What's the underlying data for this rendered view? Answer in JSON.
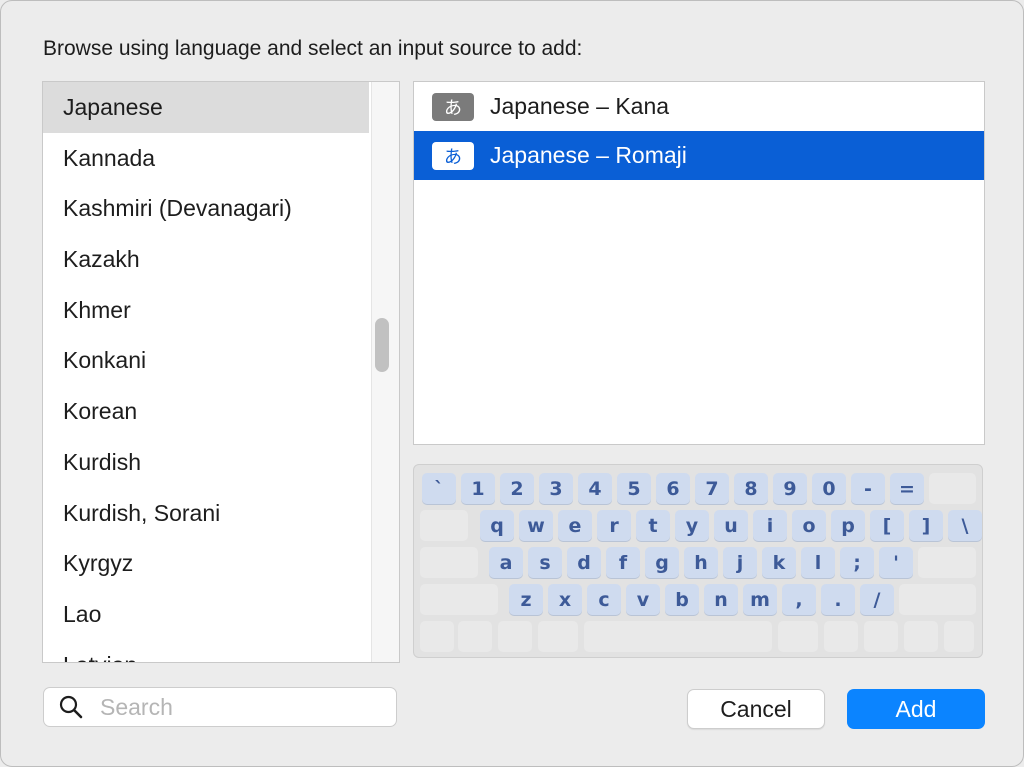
{
  "prompt": "Browse using language and select an input source to add:",
  "languages": [
    {
      "label": "Japanese",
      "selected": true
    },
    {
      "label": "Kannada"
    },
    {
      "label": "Kashmiri (Devanagari)"
    },
    {
      "label": "Kazakh"
    },
    {
      "label": "Khmer"
    },
    {
      "label": "Konkani"
    },
    {
      "label": "Korean"
    },
    {
      "label": "Kurdish"
    },
    {
      "label": "Kurdish, Sorani"
    },
    {
      "label": "Kyrgyz"
    },
    {
      "label": "Lao"
    },
    {
      "label": "Latvian"
    }
  ],
  "input_sources": [
    {
      "icon": "あ",
      "label": "Japanese – Kana",
      "selected": false
    },
    {
      "icon": "あ",
      "label": "Japanese – Romaji",
      "selected": true
    }
  ],
  "keyboard": {
    "row1": [
      "`",
      "1",
      "2",
      "3",
      "4",
      "5",
      "6",
      "7",
      "8",
      "9",
      "0",
      "-",
      "="
    ],
    "row2": [
      "q",
      "w",
      "e",
      "r",
      "t",
      "y",
      "u",
      "i",
      "o",
      "p",
      "[",
      "]",
      "\\"
    ],
    "row3": [
      "a",
      "s",
      "d",
      "f",
      "g",
      "h",
      "j",
      "k",
      "l",
      ";",
      "'"
    ],
    "row4": [
      "z",
      "x",
      "c",
      "v",
      "b",
      "n",
      "m",
      ",",
      ".",
      "/"
    ]
  },
  "search": {
    "placeholder": "Search",
    "value": "",
    "icon": "magnifier-icon"
  },
  "buttons": {
    "cancel": "Cancel",
    "add": "Add"
  },
  "colors": {
    "selection_blue": "#0a5fd6",
    "add_button": "#0b84ff",
    "key_fill": "#cfdbef",
    "key_text": "#3d5a98"
  }
}
